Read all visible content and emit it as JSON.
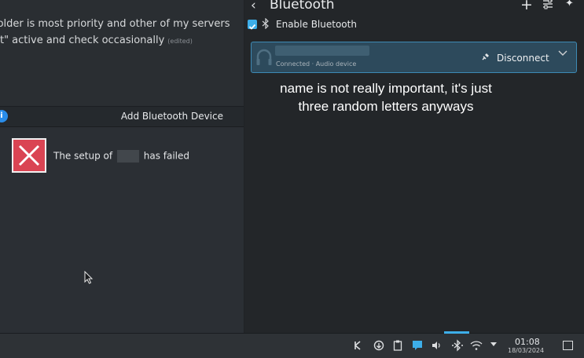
{
  "chat": {
    "line1": "folder is most priority and other of my servers",
    "line2": "at\" active and check occasionally",
    "edited": "(edited)"
  },
  "dialog": {
    "title": "Add Bluetooth Device",
    "info_icon": "i",
    "message_prefix": "The setup of",
    "message_suffix": "has failed"
  },
  "bluetooth": {
    "title": "Bluetooth",
    "back": "‹",
    "add": "+",
    "pin": "✦",
    "enable_label": "Enable Bluetooth",
    "enable_checked": true,
    "device": {
      "status": "Connected · Audio device",
      "disconnect_label": "Disconnect"
    }
  },
  "annotation": {
    "line1": "name is not really important, it's just",
    "line2": "three random letters anyways"
  },
  "taskbar": {
    "time": "01:08",
    "date": "18/03/2024"
  },
  "colors": {
    "accent": "#3daee9",
    "error": "#da4453",
    "device_bg": "#2d4a5c"
  }
}
